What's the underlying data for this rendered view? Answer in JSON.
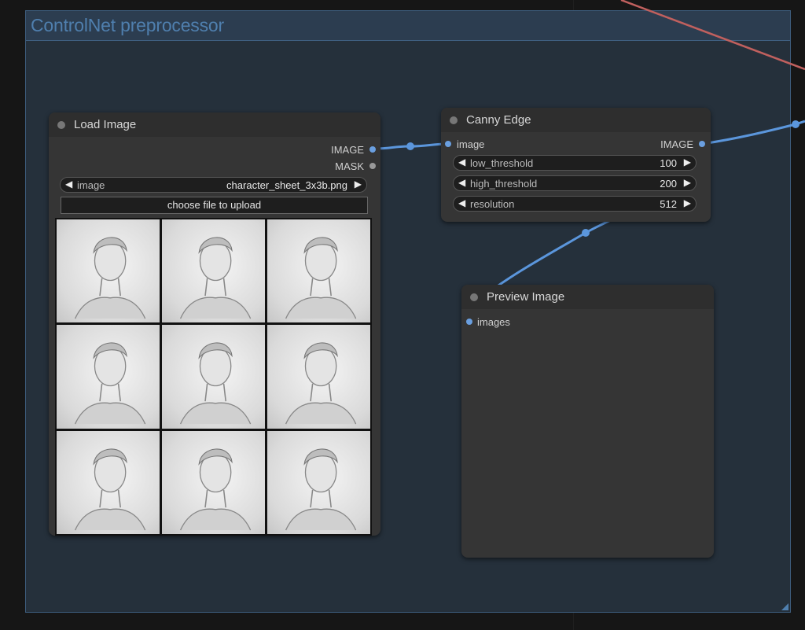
{
  "group": {
    "title": "ControlNet preprocessor"
  },
  "load_image": {
    "title": "Load Image",
    "outputs": [
      "IMAGE",
      "MASK"
    ],
    "image_widget": {
      "label": "image",
      "value": "character_sheet_3x3b.png"
    },
    "upload_label": "choose file to upload",
    "preview_cells": 9
  },
  "canny": {
    "title": "Canny Edge",
    "input": "image",
    "output": "IMAGE",
    "widgets": [
      {
        "label": "low_threshold",
        "value": "100"
      },
      {
        "label": "high_threshold",
        "value": "200"
      },
      {
        "label": "resolution",
        "value": "512"
      }
    ]
  },
  "preview": {
    "title": "Preview Image",
    "input": "images"
  },
  "colors": {
    "link_image": "#5b96dc",
    "link_other": "#c0605e",
    "group_title": "#4f7fae",
    "node_body": "#353535"
  }
}
